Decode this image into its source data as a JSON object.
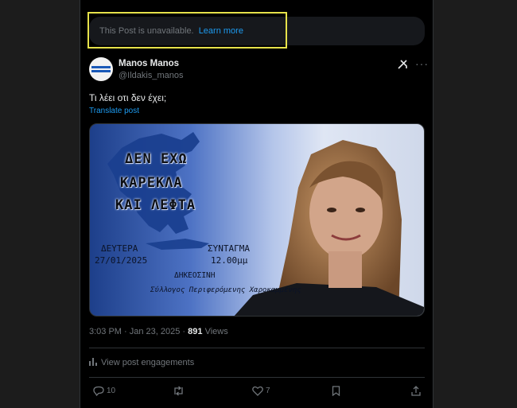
{
  "notice": {
    "text": "This Post is unavailable.",
    "link": "Learn more"
  },
  "author": {
    "name": "Manos Manos",
    "handle": "@Ildakis_manos"
  },
  "post": {
    "text": "Τι λέει οτι δεν έχει;",
    "translate": "Translate post"
  },
  "poster": {
    "line1": "ΔΕΝ ΕΧΩ",
    "line2": "ΚΑΡΕΚΛΑ",
    "line3": "ΚΑΙ ΛΕΦΤΑ",
    "day": "ΔΕΥΤΕΡΑ",
    "date": "27/01/2025",
    "place": "ΣΥΝΤΑΓΜΑ",
    "time": "12.00μμ",
    "org": "ΔΗΚΕΟΣΙΝΗ",
    "assoc": "Σύλλογος Περιφερόμενης Χαροκαμμένης"
  },
  "meta": {
    "time": "3:03 PM · Jan 23, 2025 ·",
    "views_count": "891",
    "views_label": "Views"
  },
  "engagements": "View post engagements",
  "actions": {
    "replies": "10",
    "reposts": "",
    "likes": "7"
  },
  "colors": {
    "accent": "#1d9bf0",
    "highlight": "#e6e24a"
  }
}
